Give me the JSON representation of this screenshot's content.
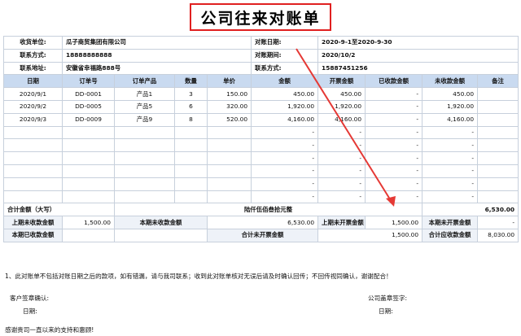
{
  "title": "公司往来对账单",
  "info": {
    "row1": {
      "label_left": "收货单位:",
      "value_left": "瓜子商贸集团有限公司",
      "label_right": "对账日期:",
      "value_right": "2020-9-1至2020-9-30"
    },
    "row2": {
      "label_left": "联系方式:",
      "value_left": "18888888888",
      "label_right": "对账期间:",
      "value_right": "2020/10/2"
    },
    "row3": {
      "label_left": "联系地址:",
      "value_left": "安徽省幸福路888号",
      "label_right": "联系方式:",
      "value_right": "15887451256"
    }
  },
  "columns": [
    "日期",
    "订单号",
    "订单产品",
    "数量",
    "单价",
    "金额",
    "开票金额",
    "已收款金额",
    "未收款金额",
    "备注"
  ],
  "rows": [
    [
      "2020/9/1",
      "DD-0001",
      "产品1",
      "3",
      "150.00",
      "450.00",
      "450.00",
      "-",
      "450.00",
      ""
    ],
    [
      "2020/9/2",
      "DD-0005",
      "产品5",
      "6",
      "320.00",
      "1,920.00",
      "1,920.00",
      "-",
      "1,920.00",
      ""
    ],
    [
      "2020/9/3",
      "DD-0009",
      "产品9",
      "8",
      "520.00",
      "4,160.00",
      "4,160.00",
      "-",
      "4,160.00",
      ""
    ],
    [
      "",
      "",
      "",
      "",
      "",
      "-",
      "-",
      "-",
      "-",
      ""
    ],
    [
      "",
      "",
      "",
      "",
      "",
      "-",
      "-",
      "-",
      "-",
      ""
    ],
    [
      "",
      "",
      "",
      "",
      "",
      "-",
      "-",
      "-",
      "-",
      ""
    ],
    [
      "",
      "",
      "",
      "",
      "",
      "-",
      "-",
      "-",
      "-",
      ""
    ],
    [
      "",
      "",
      "",
      "",
      "",
      "-",
      "-",
      "-",
      "-",
      ""
    ],
    [
      "",
      "",
      "",
      "",
      "",
      "-",
      "-",
      "-",
      "-",
      ""
    ]
  ],
  "total": {
    "label": "合计金额（大写）",
    "words": "陆仟伍佰叁拾元整",
    "amount": "6,530.00"
  },
  "summary1": {
    "a_label": "上期未收款金额",
    "a_value": "1,500.00",
    "b_label": "本期未收款金额",
    "b_value": "6,530.00",
    "c_label": "上期未开票金额",
    "c_value": "1,500.00",
    "d_label": "本期未开票金额",
    "d_value": "-"
  },
  "summary2": {
    "a_label": "本期已收款金额",
    "a_value": "",
    "b_label": "合计未开票金额",
    "b_value": "",
    "c_value": "1,500.00",
    "d_label": "合计应收款金额",
    "d_value": "8,030.00"
  },
  "notes": {
    "note1": "1、此对账单不包括对账日期之后的款项，如有错漏，请与我司联系；收到此对账单核对无误后请及时确认回传；不回传视同确认，谢谢配合！",
    "customer_sign": "客户签章确认:",
    "customer_date": "日期:",
    "company_sign": "公司盖章签字:",
    "company_date": "日期:",
    "thanks": "感谢贵司一直以来的支持和惠顾!"
  },
  "colors": {
    "accent_red": "#e02020",
    "header_blue": "#c9daf0",
    "grid": "#c7d0dc"
  }
}
